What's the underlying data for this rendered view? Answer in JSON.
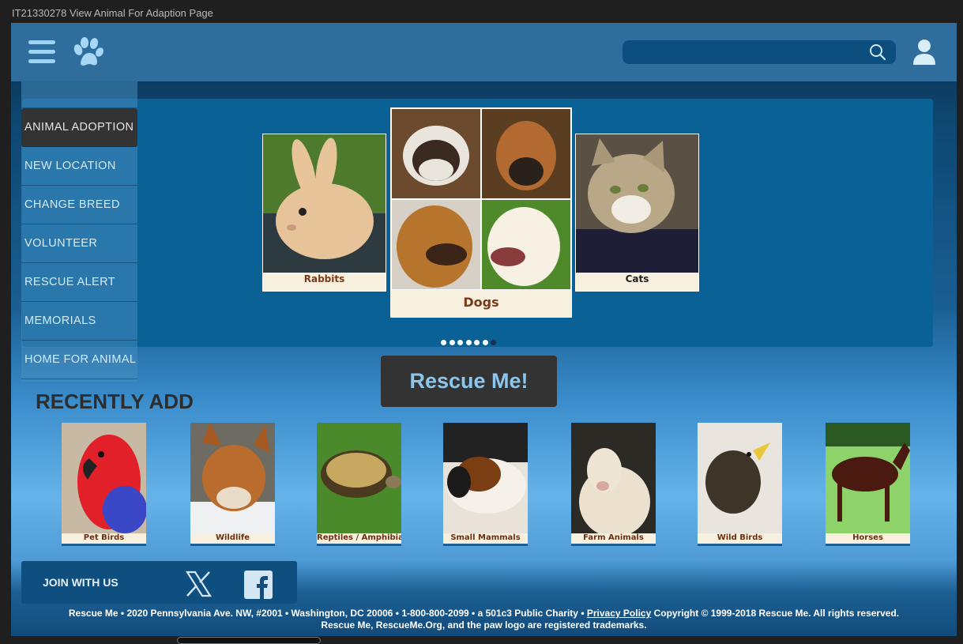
{
  "window": {
    "title": "IT21330278 View Animal For Adaption Page"
  },
  "header": {
    "search_placeholder": ""
  },
  "sidebar": {
    "items": [
      {
        "label": "ANIMAL ADOPTION",
        "active": true
      },
      {
        "label": "NEW LOCATION"
      },
      {
        "label": "CHANGE BREED"
      },
      {
        "label": "VOLUNTEER"
      },
      {
        "label": "RESCUE ALERT"
      },
      {
        "label": "MEMORIALS"
      },
      {
        "label": "HOME FOR ANIMAL"
      }
    ]
  },
  "carousel": {
    "cards": [
      {
        "label": "Rabbits"
      },
      {
        "label": "Dogs"
      },
      {
        "label": "Cats"
      }
    ],
    "dot_count": 7,
    "active_dot": 7
  },
  "cta": {
    "label": "Rescue Me!"
  },
  "recent": {
    "title": "RECENTLY ADD",
    "items": [
      {
        "label": "Pet Birds"
      },
      {
        "label": "Wildlife"
      },
      {
        "label": "Reptiles / Amphibians"
      },
      {
        "label": "Small Mammals"
      },
      {
        "label": "Farm Animals"
      },
      {
        "label": "Wild Birds"
      },
      {
        "label": "Horses"
      }
    ]
  },
  "join": {
    "label": "JOIN WITH US"
  },
  "footer": {
    "line1_pre": "Rescue Me • 2020 Pennsylvania Ave. NW, #2001 • Washington, DC 20006 • 1-800-800-2099 • a 501c3 Public Charity • ",
    "privacy": "Privacy Policy",
    "line1_post": " Copyright © 1999-2018 Rescue Me. All rights reserved.",
    "line2": "Rescue Me, RescueMe.Org, and the paw logo are registered trademarks."
  },
  "colors": {
    "accent": "#8cc6ec",
    "topbar": "#2f6e9c",
    "label_text": "#7a3a1a"
  }
}
